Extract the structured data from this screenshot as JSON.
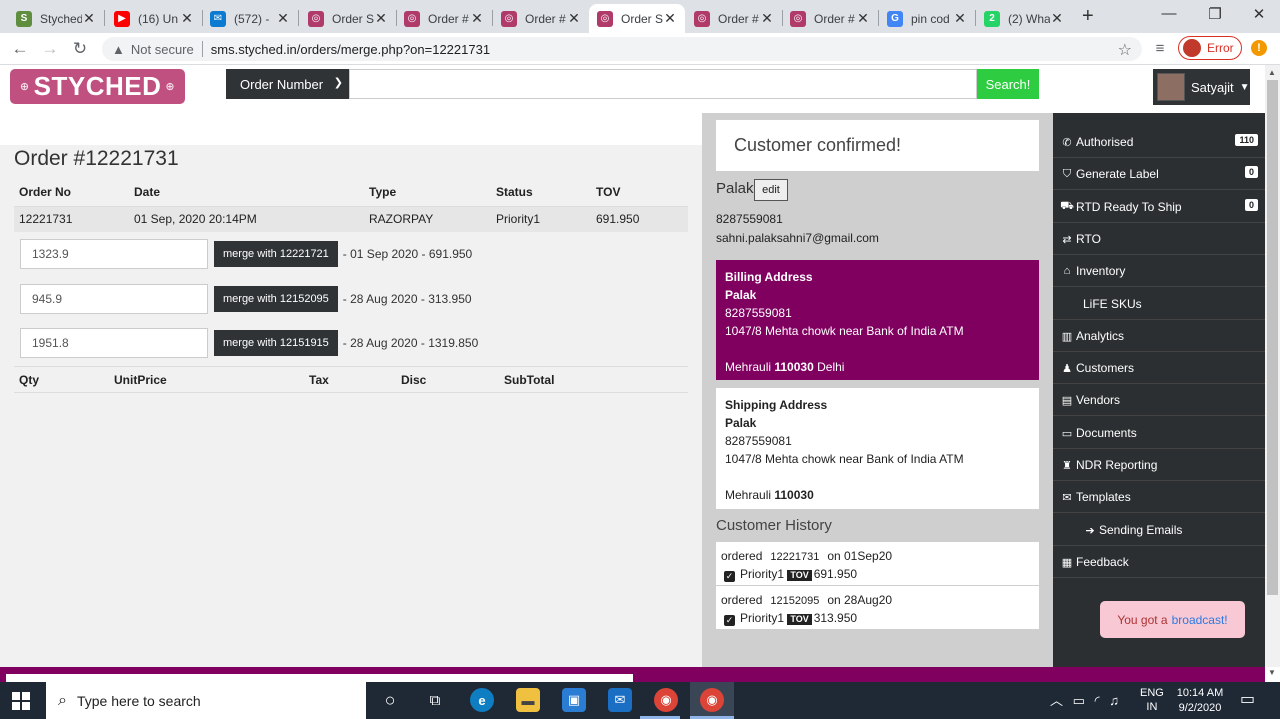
{
  "browser": {
    "tabs": [
      {
        "title": "Styched",
        "icon": "shopify-icon",
        "color": "#5e8e3e",
        "glyph": "S"
      },
      {
        "title": "(16) Un",
        "icon": "youtube-icon",
        "color": "#ff0000",
        "glyph": "▶"
      },
      {
        "title": "(572) -",
        "icon": "mail-icon",
        "color": "#0b7ad1",
        "glyph": "✉"
      },
      {
        "title": "Order S",
        "icon": "styched-icon",
        "color": "#b03a6a",
        "glyph": "◎"
      },
      {
        "title": "Order #",
        "icon": "styched-icon",
        "color": "#b03a6a",
        "glyph": "◎"
      },
      {
        "title": "Order #",
        "icon": "styched-icon",
        "color": "#b03a6a",
        "glyph": "◎"
      },
      {
        "title": "Order S",
        "icon": "styched-icon",
        "color": "#b03a6a",
        "glyph": "◎"
      },
      {
        "title": "Order #",
        "icon": "styched-icon",
        "color": "#b03a6a",
        "glyph": "◎"
      },
      {
        "title": "Order #",
        "icon": "styched-icon",
        "color": "#b03a6a",
        "glyph": "◎"
      },
      {
        "title": "pin cod",
        "icon": "google-icon",
        "color": "#4285f4",
        "glyph": "G"
      },
      {
        "title": "(2) Wha",
        "icon": "whatsapp-icon",
        "color": "#25d366",
        "glyph": "2"
      }
    ],
    "active_tab": 6,
    "security_label": "Not secure",
    "url": "sms.styched.in/orders/merge.php?on=12221731",
    "error_label": "Error"
  },
  "header": {
    "logo": "STYCHED",
    "search_type": "Order Number",
    "search_placeholder": "",
    "search_button": "Search!",
    "user_name": "Satyajit"
  },
  "order": {
    "title": "Order #12221731",
    "columns": [
      "Order No",
      "Date",
      "Type",
      "Status",
      "TOV"
    ],
    "row": [
      "12221731",
      "01 Sep, 2020 20:14PM",
      "RAZORPAY",
      "Priority1",
      "691.950"
    ],
    "merges": [
      {
        "value": "1323.9",
        "button": "merge with 12221721",
        "info": "- 01 Sep 2020 - 691.950"
      },
      {
        "value": "945.9",
        "button": "merge with 12152095",
        "info": "- 28 Aug 2020 - 313.950"
      },
      {
        "value": "1951.8",
        "button": "merge with 12151915",
        "info": "- 28 Aug 2020 - 1319.850"
      }
    ],
    "item_columns": [
      "Qty",
      "UnitPrice",
      "Tax",
      "Disc",
      "SubTotal"
    ]
  },
  "customer": {
    "confirmed": "Customer confirmed!",
    "name": "Palak",
    "edit_label": "edit",
    "phone": "8287559081",
    "email": "sahni.palaksahni7@gmail.com",
    "billing": {
      "heading": "Billing Address",
      "name": "Palak",
      "phone": "8287559081",
      "line1": "1047/8 Mehta chowk near Bank of India ATM",
      "city": "Mehrauli",
      "pin": "110030",
      "state": "Delhi"
    },
    "shipping": {
      "heading": "Shipping Address",
      "name": "Palak",
      "phone": "8287559081",
      "line1": "1047/8 Mehta chowk near Bank of India ATM",
      "city": "Mehrauli",
      "pin": "110030"
    },
    "history_title": "Customer History",
    "history": [
      {
        "verb": "ordered",
        "order_no": "12221731",
        "on": "on 01Sep20",
        "status": "Priority1",
        "tov_label": "TOV",
        "tov": "691.950"
      },
      {
        "verb": "ordered",
        "order_no": "12152095",
        "on": "on 28Aug20",
        "status": "Priority1",
        "tov_label": "TOV",
        "tov": "313.950"
      }
    ]
  },
  "sidebar": {
    "items": [
      {
        "label": "Authorised",
        "icon": "phone-icon",
        "glyph": "✆",
        "badge": "110"
      },
      {
        "label": "Generate Label",
        "icon": "tag-icon",
        "glyph": "⛉",
        "badge": "0"
      },
      {
        "label": "RTD Ready To Ship",
        "icon": "truck-icon",
        "glyph": "⛟",
        "badge": "0"
      },
      {
        "label": "RTO",
        "icon": "exchange-icon",
        "glyph": "⇄",
        "badge": ""
      },
      {
        "label": "Inventory",
        "icon": "home-icon",
        "glyph": "⌂",
        "badge": ""
      },
      {
        "label": "LiFE SKUs",
        "icon": "",
        "glyph": "",
        "badge": "",
        "sub": true
      },
      {
        "label": "Analytics",
        "icon": "barcode-icon",
        "glyph": "▥",
        "badge": ""
      },
      {
        "label": "Customers",
        "icon": "user-icon",
        "glyph": "♟",
        "badge": ""
      },
      {
        "label": "Vendors",
        "icon": "file-icon",
        "glyph": "▤",
        "badge": ""
      },
      {
        "label": "Documents",
        "icon": "card-icon",
        "glyph": "▭",
        "badge": ""
      },
      {
        "label": "NDR Reporting",
        "icon": "user-secret-icon",
        "glyph": "♜",
        "badge": ""
      },
      {
        "label": "Templates",
        "icon": "envelope-icon",
        "glyph": "✉",
        "badge": ""
      },
      {
        "label": "Sending Emails",
        "icon": "arrow-right-icon",
        "glyph": "➔",
        "badge": "",
        "sub": true
      },
      {
        "label": "Feedback",
        "icon": "table-icon",
        "glyph": "▦",
        "badge": ""
      }
    ],
    "broadcast_text": "You got a",
    "broadcast_link": "broadcast!"
  },
  "taskbar": {
    "search_placeholder": "Type here to search",
    "lang_top": "ENG",
    "lang_bottom": "IN",
    "time": "10:14 AM",
    "date": "9/2/2020"
  },
  "colors": {
    "brand": "#c05080",
    "billing_bg": "#800060",
    "search_button": "#2ecc40",
    "sidebar_bg": "#2c2f31"
  }
}
